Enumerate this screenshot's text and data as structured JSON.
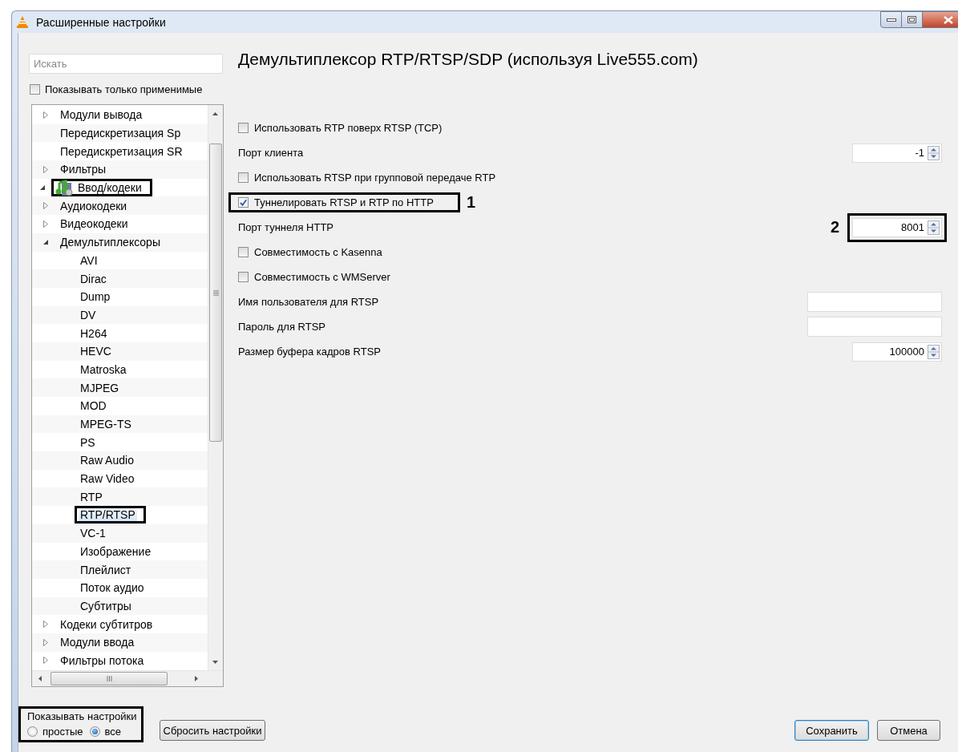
{
  "window": {
    "title": "Расширенные настройки"
  },
  "search": {
    "placeholder": "Искать"
  },
  "only_applicable": {
    "label": "Показывать только применимые",
    "checked": false
  },
  "tree": {
    "items": [
      {
        "children": [
          {
            "label": "Модули вывода",
            "expanded": false,
            "selected": false,
            "annotated": false
          },
          {
            "label": "Передискретизация Sp",
            "selected": false,
            "annotated": false
          },
          {
            "label": "Передискретизация SR",
            "selected": false,
            "annotated": false
          },
          {
            "label": "Фильтры",
            "expanded": false,
            "selected": false,
            "annotated": false
          }
        ]
      },
      {
        "label": "Ввод/кодеки",
        "expanded": true,
        "selected": false,
        "annotated": true,
        "children": [
          {
            "label": "Аудиокодеки",
            "expanded": false,
            "selected": false,
            "annotated": false
          },
          {
            "label": "Видеокодеки",
            "expanded": false,
            "selected": false,
            "annotated": false
          },
          {
            "label": "Демультиплексоры",
            "expanded": true,
            "selected": false,
            "annotated": false,
            "children": [
              {
                "label": "AVI",
                "selected": false,
                "annotated": false
              },
              {
                "label": "Dirac",
                "selected": false,
                "annotated": false
              },
              {
                "label": "Dump",
                "selected": false,
                "annotated": false
              },
              {
                "label": "DV",
                "selected": false,
                "annotated": false
              },
              {
                "label": "H264",
                "selected": false,
                "annotated": false
              },
              {
                "label": "HEVC",
                "selected": false,
                "annotated": false
              },
              {
                "label": "Matroska",
                "selected": false,
                "annotated": false
              },
              {
                "label": "MJPEG",
                "selected": false,
                "annotated": false
              },
              {
                "label": "MOD",
                "selected": false,
                "annotated": false
              },
              {
                "label": "MPEG-TS",
                "selected": false,
                "annotated": false
              },
              {
                "label": "PS",
                "selected": false,
                "annotated": false
              },
              {
                "label": "Raw Audio",
                "selected": false,
                "annotated": false
              },
              {
                "label": "Raw Video",
                "selected": false,
                "annotated": false
              },
              {
                "label": "RTP",
                "selected": false,
                "annotated": false
              },
              {
                "label": "RTP/RTSP",
                "selected": true,
                "annotated": true
              },
              {
                "label": "VC-1",
                "selected": false,
                "annotated": false
              },
              {
                "label": "Изображение",
                "selected": false,
                "annotated": false
              },
              {
                "label": "Плейлист",
                "selected": false,
                "annotated": false
              },
              {
                "label": "Поток аудио",
                "selected": false,
                "annotated": false
              },
              {
                "label": "Субтитры",
                "selected": false,
                "annotated": false
              }
            ]
          },
          {
            "label": "Кодеки субтитров",
            "expanded": false,
            "selected": false,
            "annotated": false
          },
          {
            "label": "Модули ввода",
            "expanded": false,
            "selected": false,
            "annotated": false
          },
          {
            "label": "Фильтры потока",
            "expanded": false,
            "selected": false,
            "annotated": false
          }
        ]
      }
    ]
  },
  "panel": {
    "title": "Демультиплексор RTP/RTSP/SDP (используя Live555.com)",
    "options": [
      {
        "kind": "checkbox",
        "label": "Использовать RTP поверх RTSP (TCP)",
        "checked": false,
        "annotated": false
      },
      {
        "kind": "spin",
        "label": "Порт клиента",
        "value": "-1",
        "annotated": false
      },
      {
        "kind": "checkbox",
        "label": "Использовать RTSP при групповой передаче RTP",
        "checked": false,
        "annotated": false
      },
      {
        "kind": "checkbox",
        "label": "Туннелировать RTSP и RTP по HTTP",
        "checked": true,
        "annotated": true,
        "callout": "1"
      },
      {
        "kind": "spin",
        "label": "Порт туннеля HTTP",
        "value": "8001",
        "annotated": true,
        "callout": "2"
      },
      {
        "kind": "checkbox",
        "label": "Совместимость с Kasenna",
        "checked": false,
        "annotated": false
      },
      {
        "kind": "checkbox",
        "label": "Совместимость с WMServer",
        "checked": false,
        "annotated": false
      },
      {
        "kind": "text",
        "label": "Имя пользователя для RTSP",
        "annotated": false
      },
      {
        "kind": "text",
        "label": "Пароль для RTSP",
        "annotated": false
      },
      {
        "kind": "spin",
        "label": "Размер буфера кадров RTSP",
        "value": "100000",
        "annotated": false
      }
    ]
  },
  "show_settings": {
    "title": "Показывать настройки",
    "annotated": true,
    "options": [
      {
        "label": "простые",
        "selected": false
      },
      {
        "label": "все",
        "selected": true
      }
    ]
  },
  "buttons": [
    {
      "label": "Сбросить настройки",
      "kind": "reset"
    },
    {
      "label": "Сохранить",
      "kind": "default"
    },
    {
      "label": "Отмена",
      "kind": "normal"
    }
  ]
}
